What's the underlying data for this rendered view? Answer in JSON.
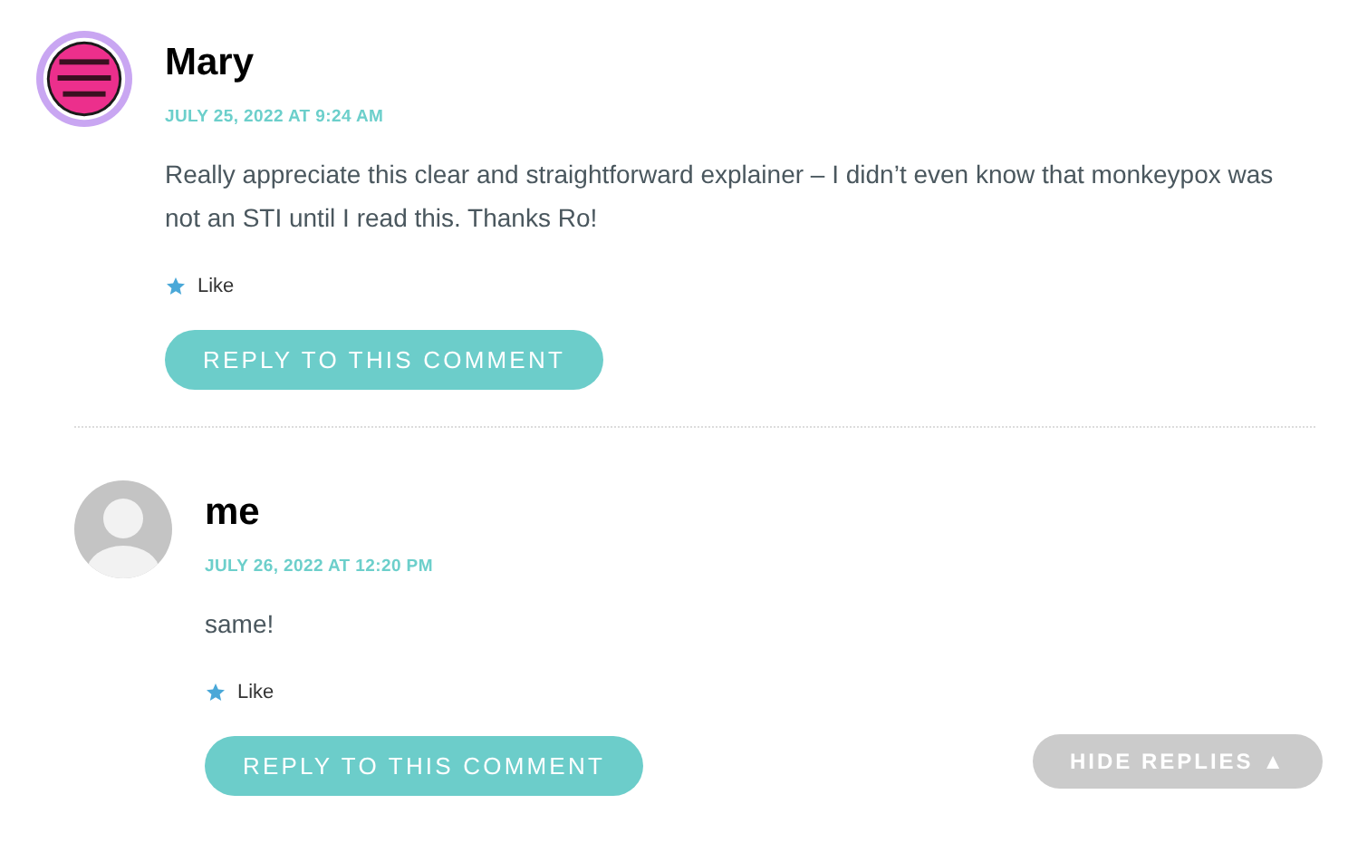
{
  "comments": [
    {
      "author": "Mary",
      "date": "JULY 25, 2022 AT 9:24 AM",
      "text": "Really appreciate this clear and straightforward explainer – I didn’t even know that monkeypox was not an STI until I read this. Thanks Ro!",
      "like": "Like",
      "reply_button": "REPLY TO THIS COMMENT",
      "replies": [
        {
          "author": "me",
          "avatar": {
            "kind": "silhouette"
          },
          "date": "JULY 26, 2022 AT 12:20 PM",
          "text": "same!",
          "like": "Like",
          "reply_button": "REPLY TO THIS COMMENT"
        }
      ]
    }
  ],
  "hide_replies": {
    "label": "HIDE REPLIES",
    "arrow": "▲"
  }
}
